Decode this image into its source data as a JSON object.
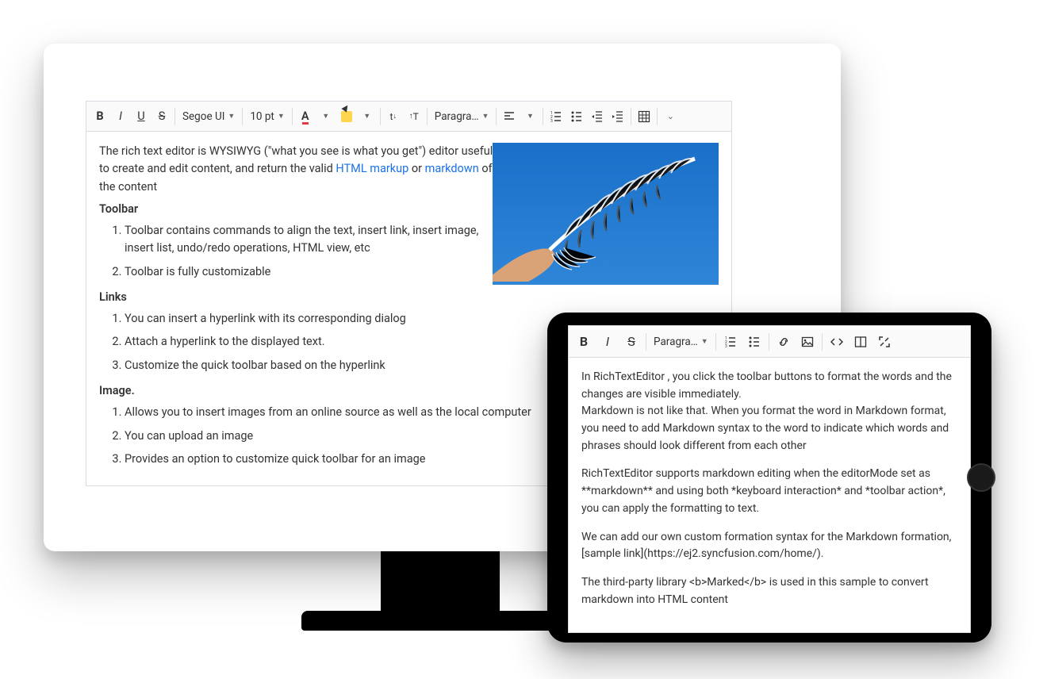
{
  "desktop": {
    "toolbar": {
      "font_name": "Segoe UI",
      "font_size": "10 pt",
      "paragraph": "Paragra…"
    },
    "content": {
      "intro_pre": "The rich text editor is WYSIWYG (\"what you see is what you get\") editor useful to create and edit content, and return the valid ",
      "link1": "HTML markup",
      "intro_mid": " or ",
      "link2": "markdown",
      "intro_post": " of the content",
      "h_toolbar": "Toolbar",
      "toolbar_items": [
        "Toolbar contains commands to align the text, insert link, insert image, insert list, undo/redo operations, HTML view, etc",
        "Toolbar is fully customizable"
      ],
      "h_links": "Links",
      "links_items": [
        "You can insert a hyperlink with its corresponding dialog",
        "Attach a hyperlink to the displayed text.",
        "Customize the quick toolbar based on the hyperlink"
      ],
      "h_image": "Image.",
      "image_items": [
        "Allows you to insert images from an online source as well as the local computer",
        "You can upload an image",
        "Provides an option to customize quick toolbar for an image"
      ]
    }
  },
  "tablet": {
    "toolbar": {
      "paragraph": "Paragra…"
    },
    "content": {
      "p1a": "In RichTextEditor , you click the toolbar buttons to format the words and the changes are visible immediately.",
      "p1b": "Markdown is not like that. When you format the word in Markdown format, you need to add Markdown syntax to the word to indicate which words and phrases should look different from each other",
      "p2": "RichTextEditor supports markdown editing when the editorMode set as **markdown** and using both *keyboard interaction* and *toolbar action*, you can apply the formatting to text.",
      "p3": "We can add our own custom formation syntax for the Markdown formation, [sample link](https://ej2.syncfusion.com/home/).",
      "p4": "The third-party library <b>Marked</b> is used in this sample to convert markdown into HTML content"
    }
  }
}
